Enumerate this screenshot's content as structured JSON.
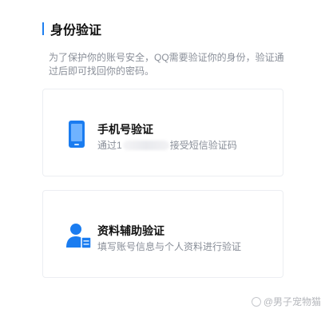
{
  "header": {
    "title": "身份验证",
    "accent_color": "#1e7ff0"
  },
  "description": "为了保护你的账号安全，QQ需要验证你的身份，验证通过后即可找回你的密码。",
  "options": [
    {
      "title": "手机号验证",
      "subtitle_prefix": "通过1",
      "subtitle_suffix": "接受短信验证码",
      "icon": "mobile-phone-icon"
    },
    {
      "title": "资料辅助验证",
      "subtitle": "填写账号信息与个人资料进行验证",
      "icon": "user-profile-icon"
    }
  ],
  "watermark": "@男子宠物猫"
}
